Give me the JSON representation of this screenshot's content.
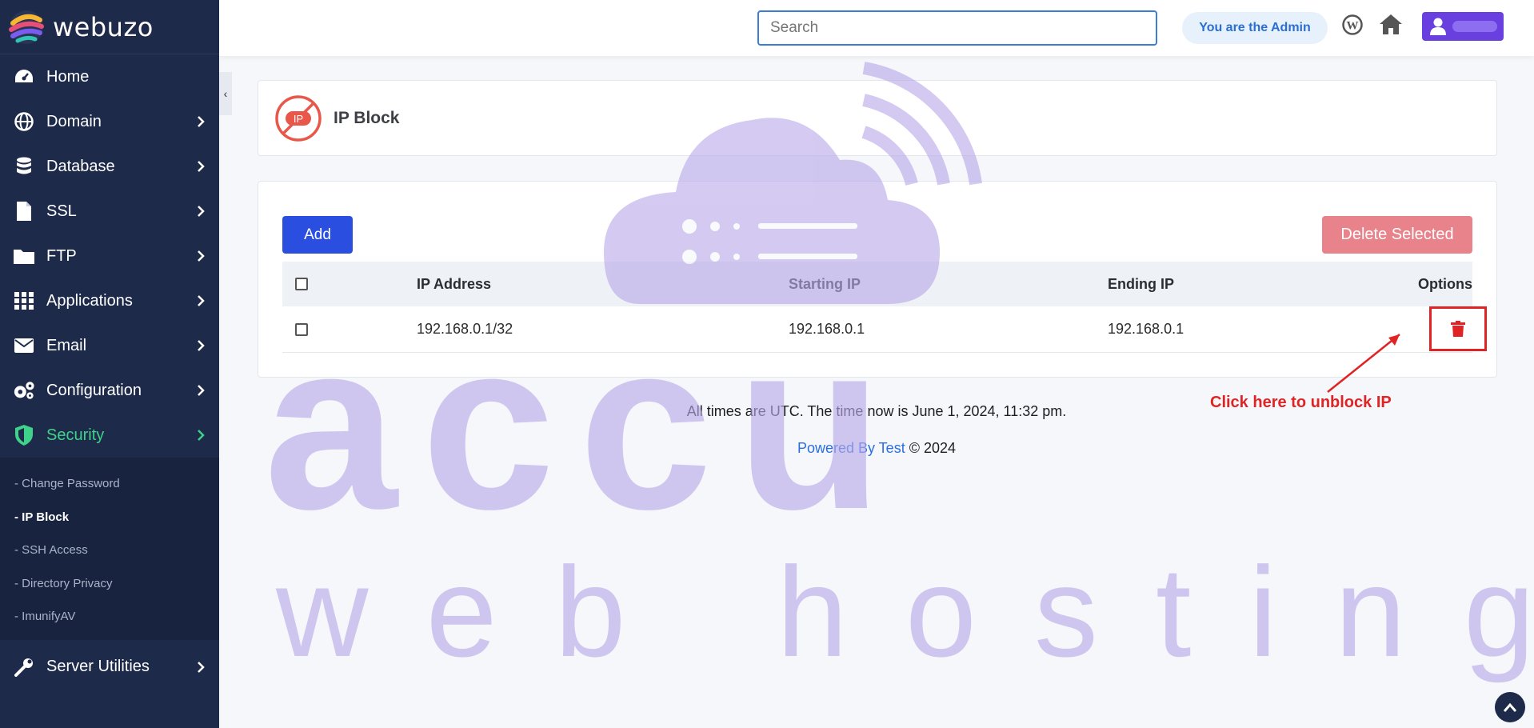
{
  "brand": {
    "name": "webuzo"
  },
  "sidebar": {
    "items": [
      {
        "label": "Home",
        "icon": "dashboard-icon"
      },
      {
        "label": "Domain",
        "icon": "globe-icon"
      },
      {
        "label": "Database",
        "icon": "database-icon"
      },
      {
        "label": "SSL",
        "icon": "file-icon"
      },
      {
        "label": "FTP",
        "icon": "folder-icon"
      },
      {
        "label": "Applications",
        "icon": "grid-icon"
      },
      {
        "label": "Email",
        "icon": "envelope-icon"
      },
      {
        "label": "Configuration",
        "icon": "gears-icon"
      },
      {
        "label": "Security",
        "icon": "shield-icon"
      }
    ],
    "security_sub": [
      "- Change Password",
      "- IP Block",
      "- SSH Access",
      "- Directory Privacy",
      "- ImunifyAV"
    ],
    "server_utilities": "Server Utilities",
    "collapse_glyph": "‹",
    "active_color": "#3ed28b"
  },
  "header": {
    "search_placeholder": "Search",
    "admin_badge": "You are the Admin"
  },
  "page": {
    "title": "IP Block",
    "logo_text": "IP"
  },
  "toolbar": {
    "add_label": "Add",
    "delete_selected_label": "Delete Selected"
  },
  "table": {
    "columns": [
      "IP Address",
      "Starting IP",
      "Ending IP",
      "Options"
    ],
    "rows": [
      {
        "ip_address": "192.168.0.1/32",
        "starting_ip": "192.168.0.1",
        "ending_ip": "192.168.0.1"
      }
    ]
  },
  "footer": {
    "time_text": "All times are UTC. The time now is June 1, 2024, 11:32 pm.",
    "powered_link": "Powered By Test",
    "copyright": "© 2024"
  },
  "annotation": {
    "text": "Click here to unblock IP",
    "color": "#e02424"
  },
  "watermark": {
    "line1": "accu",
    "line2": "web hosting",
    "color": "#b9a9ea"
  },
  "colors": {
    "sidebar_bg": "#1e2a4a",
    "primary": "#2a4fe0",
    "danger_soft": "#e8838c",
    "danger": "#e02424"
  }
}
